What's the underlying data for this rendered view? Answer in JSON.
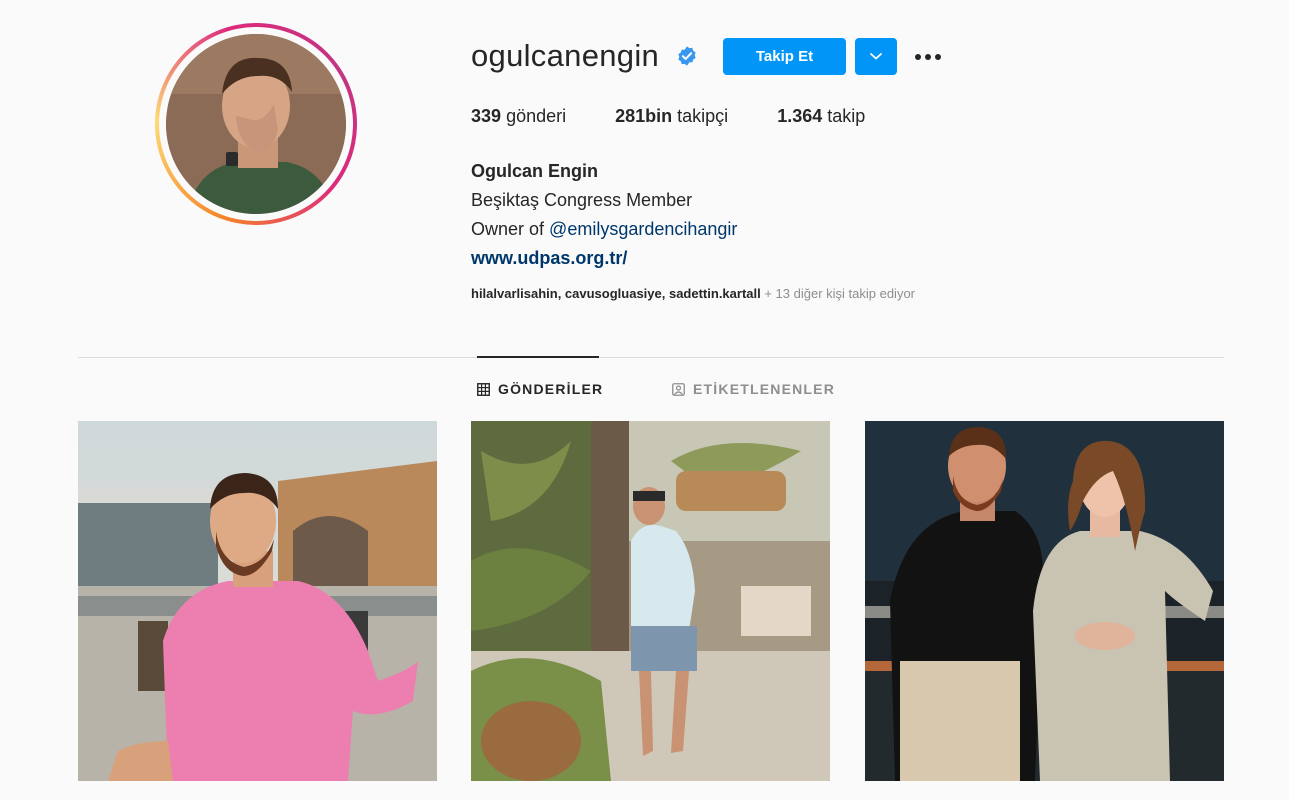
{
  "profile": {
    "username": "ogulcanengin",
    "verified": true,
    "follow_label": "Takip Et",
    "stats": {
      "posts_count": "339",
      "posts_label": "gönderi",
      "followers_count": "281bin",
      "followers_label": "takipçi",
      "following_count": "1.364",
      "following_label": "takip"
    },
    "full_name": "Ogulcan Engin",
    "bio_line1": "Beşiktaş Congress Member",
    "bio_line2_prefix": "Owner of",
    "bio_mention": "@emilysgardencihangir",
    "website": "www.udpas.org.tr/",
    "followed_by_names": "hilalvarlisahin, cavusogluasiye, sadettin.kartall",
    "followed_by_more": " + 13 diğer kişi takip ediyor"
  },
  "tabs": [
    {
      "label": "GÖNDERİLER",
      "icon": "grid-icon",
      "active": true
    },
    {
      "label": "ETİKETLENENLER",
      "icon": "tagged-icon",
      "active": false
    }
  ],
  "posts": [
    {
      "icon": "photo-man-pink-shirt-restaurant"
    },
    {
      "icon": "photo-man-palm-garden"
    },
    {
      "icon": "photo-couple-night"
    }
  ],
  "colors": {
    "accent": "#0095f6",
    "link": "#00376b",
    "text": "#262626",
    "muted": "#8e8e8e",
    "divider": "#dbdbdb",
    "background": "#fafafa"
  }
}
